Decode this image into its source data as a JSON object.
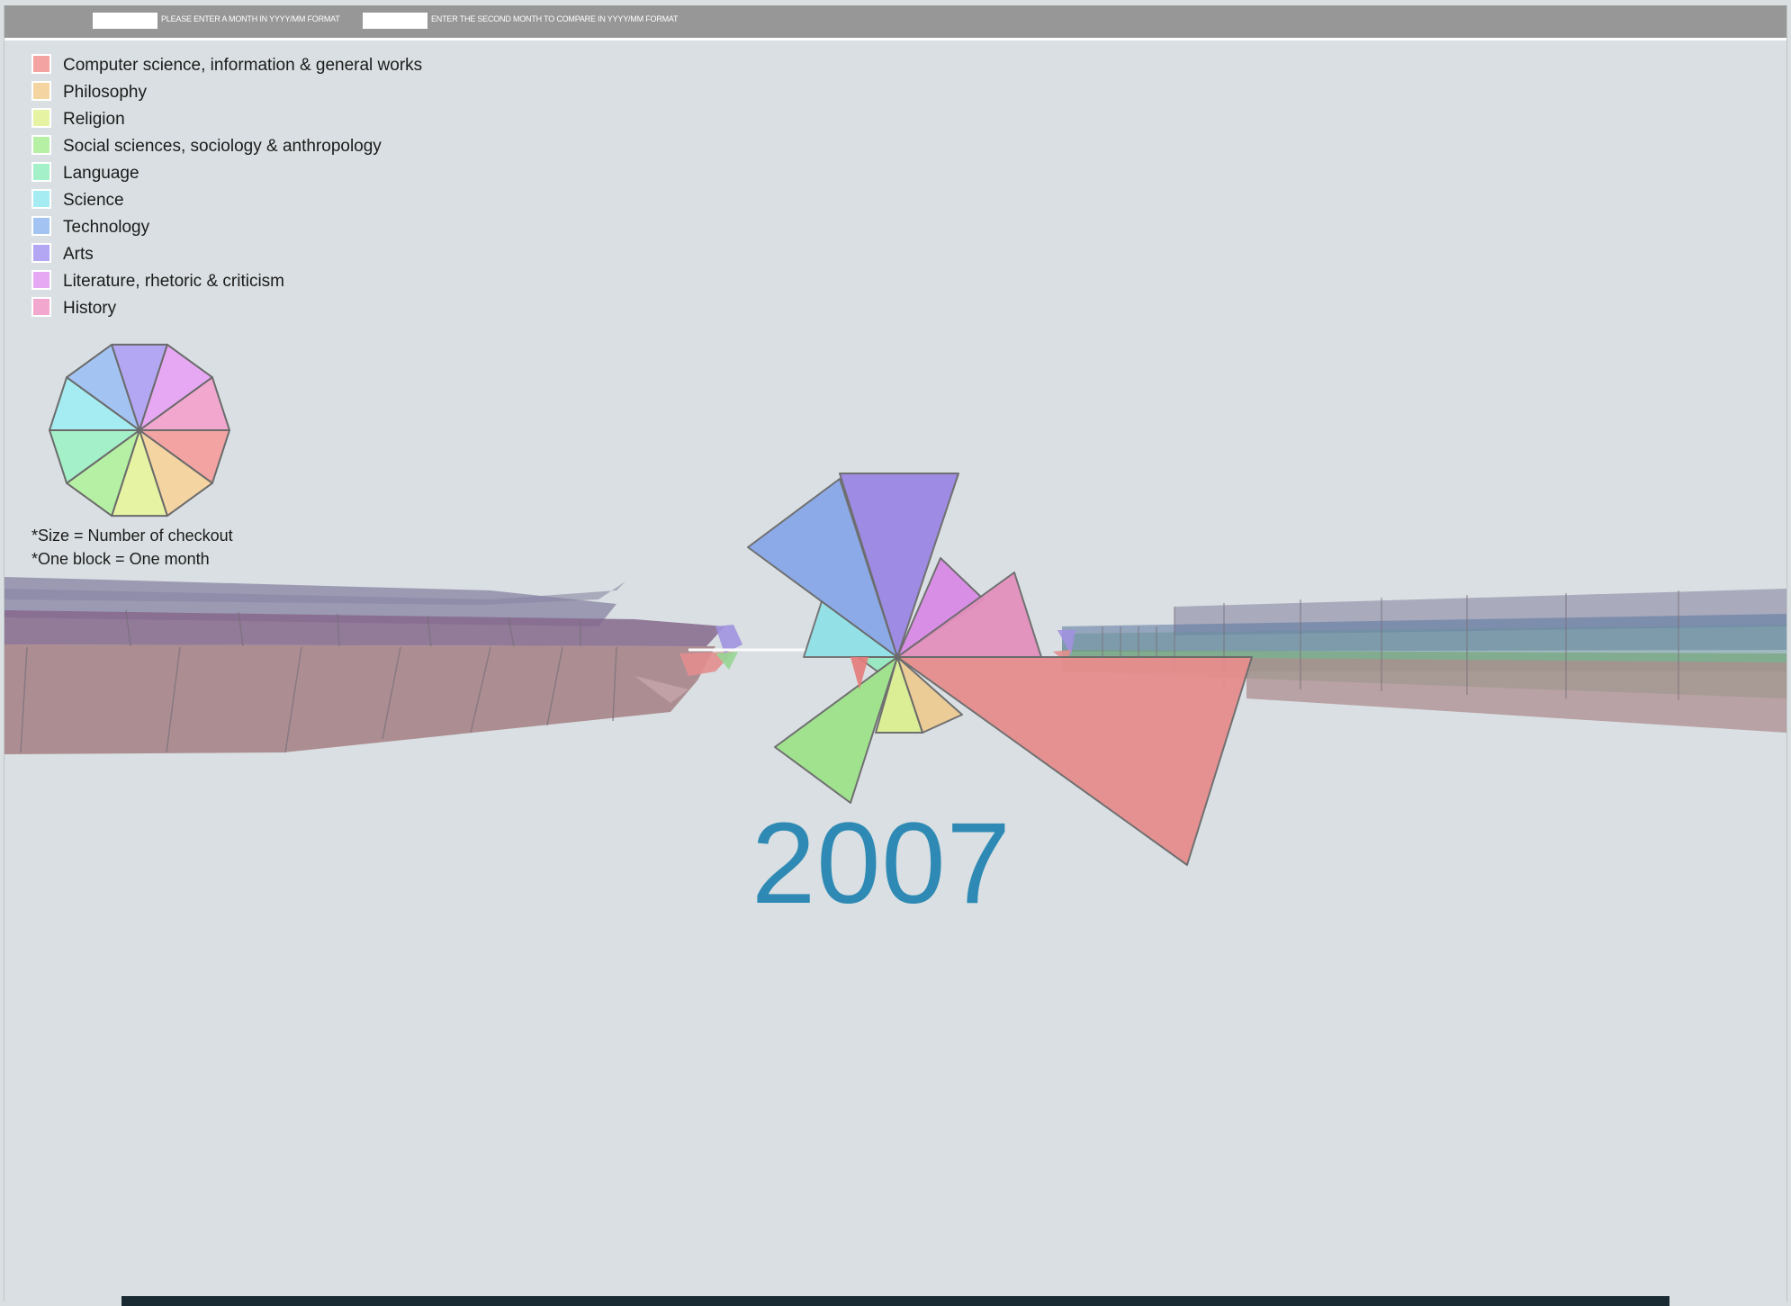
{
  "toolbar": {
    "month_input_value": "",
    "month_prompt": "PLEASE ENTER A MONTH IN YYYY/MM FORMAT",
    "compare_input_value": "",
    "compare_prompt": "ENTER THE SECOND MONTH TO COMPARE IN YYYY/MM FORMAT"
  },
  "legend": [
    {
      "label": "Computer science, information & general works",
      "color": "#f4a3a3"
    },
    {
      "label": "Philosophy",
      "color": "#f4d5a2"
    },
    {
      "label": "Religion",
      "color": "#e6f3a3"
    },
    {
      "label": "Social sciences, sociology & anthropology",
      "color": "#b5f0a4"
    },
    {
      "label": "Language",
      "color": "#a4f0c8"
    },
    {
      "label": "Science",
      "color": "#a4ecf1"
    },
    {
      "label": "Technology",
      "color": "#a3c4f3"
    },
    {
      "label": "Arts",
      "color": "#b3a6f2"
    },
    {
      "label": "Literature, rhetoric & criticism",
      "color": "#e6a8f2"
    },
    {
      "label": "History",
      "color": "#f2a7cf"
    }
  ],
  "notes": {
    "size": "*Size = Number of checkout",
    "block": "*One block = One month"
  },
  "year": "2007",
  "wheel_colors": [
    "#f4a3a3",
    "#f4d5a2",
    "#e6f3a3",
    "#b5f0a4",
    "#a4f0c8",
    "#a4ecf1",
    "#a3c4f3",
    "#b3a6f2",
    "#e6a8f2",
    "#f2a7cf"
  ]
}
